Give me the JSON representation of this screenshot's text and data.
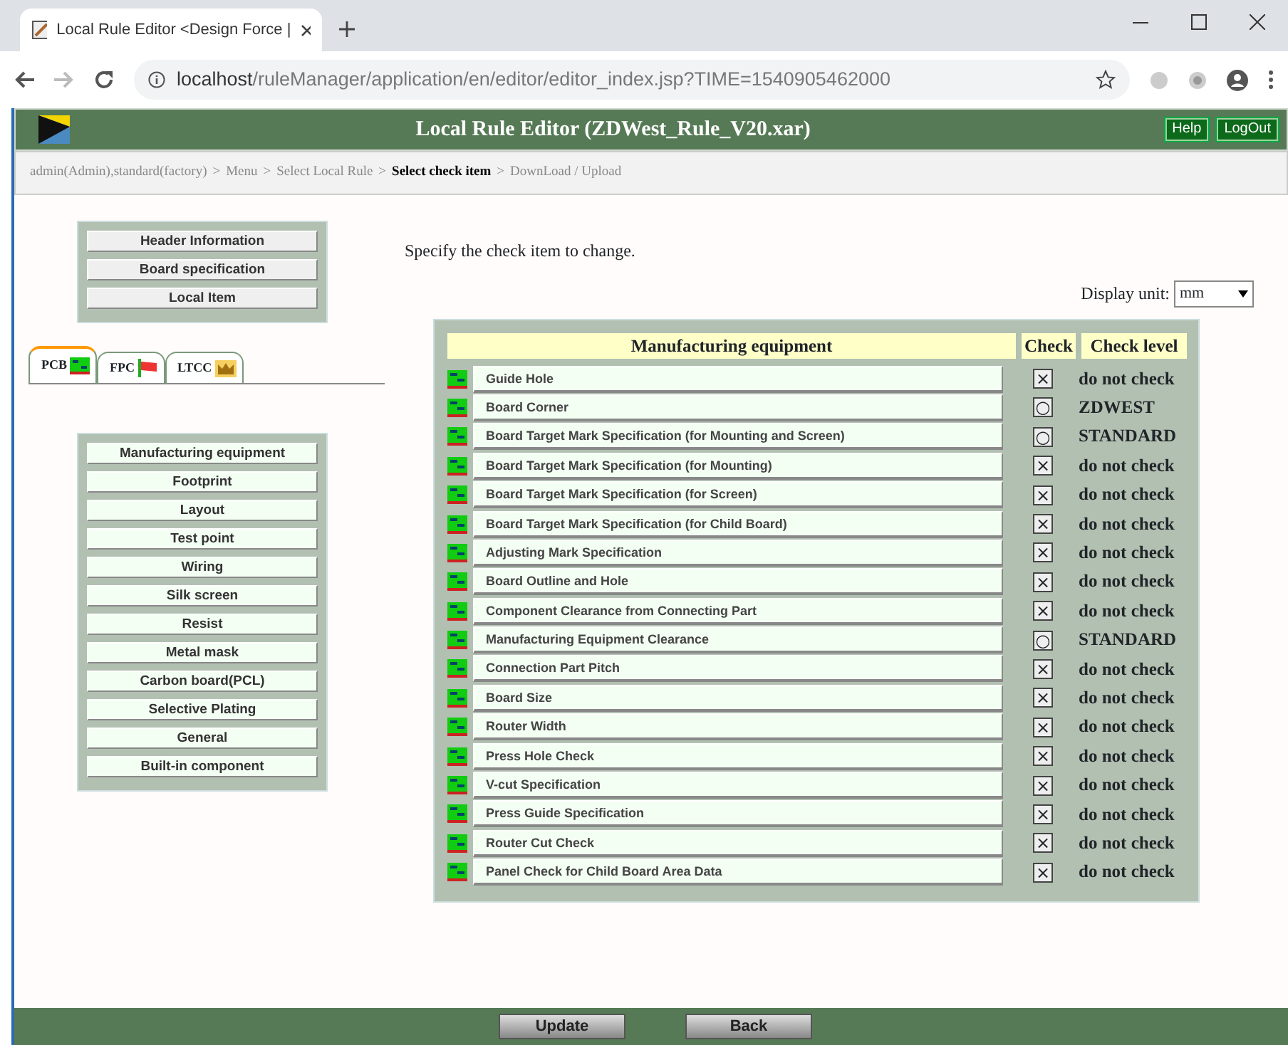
{
  "browser": {
    "tab_title": "Local Rule Editor <Design Force |",
    "url_host": "localhost",
    "url_path": "/ruleManager/application/en/editor/editor_index.jsp?TIME=1540905462000"
  },
  "header": {
    "title": "Local Rule Editor (ZDWest_Rule_V20.xar)",
    "buttons": [
      "Help",
      "LogOut"
    ]
  },
  "breadcrumb": [
    {
      "kind": "link",
      "label": "admin(Admin),standard(factory)",
      "current": false
    },
    {
      "kind": "separator",
      "label": ">"
    },
    {
      "kind": "link",
      "label": "Menu",
      "current": false
    },
    {
      "kind": "separator",
      "label": ">"
    },
    {
      "kind": "link",
      "label": "Select Local Rule",
      "current": false
    },
    {
      "kind": "separator",
      "label": ">"
    },
    {
      "kind": "link",
      "label": "Select check item",
      "current": true
    },
    {
      "kind": "separator",
      "label": ">"
    },
    {
      "kind": "link",
      "label": "DownLoad / Upload",
      "current": false
    }
  ],
  "top_menu": [
    "Header Information",
    "Board specification",
    "Local Item"
  ],
  "board_tabs": [
    {
      "label": "PCB",
      "selected": true
    },
    {
      "label": "FPC",
      "selected": false
    },
    {
      "label": "LTCC",
      "selected": false
    }
  ],
  "categories": [
    "Manufacturing equipment",
    "Footprint",
    "Layout",
    "Test point",
    "Wiring",
    "Silk screen",
    "Resist",
    "Metal mask",
    "Carbon board(PCL)",
    "Selective Plating",
    "General",
    "Built-in component"
  ],
  "instruction": "Specify the check item to change.",
  "display_unit": {
    "label": "Display unit:",
    "value": "mm"
  },
  "table": {
    "columns": [
      "Manufacturing equipment",
      "Check",
      "Check level"
    ],
    "rows": [
      {
        "item": "Guide Hole",
        "check": "×",
        "level": "do not check"
      },
      {
        "item": "Board Corner",
        "check": "○",
        "level": "ZDWEST"
      },
      {
        "item": "Board Target Mark Specification (for Mounting and Screen)",
        "check": "○",
        "level": "STANDARD"
      },
      {
        "item": "Board Target Mark Specification (for Mounting)",
        "check": "×",
        "level": "do not check"
      },
      {
        "item": "Board Target Mark Specification (for Screen)",
        "check": "×",
        "level": "do not check"
      },
      {
        "item": "Board Target Mark Specification (for Child Board)",
        "check": "×",
        "level": "do not check"
      },
      {
        "item": "Adjusting Mark Specification",
        "check": "×",
        "level": "do not check"
      },
      {
        "item": "Board Outline and Hole",
        "check": "×",
        "level": "do not check"
      },
      {
        "item": "Component Clearance from Connecting Part",
        "check": "×",
        "level": "do not check"
      },
      {
        "item": "Manufacturing Equipment Clearance",
        "check": "○",
        "level": "STANDARD"
      },
      {
        "item": "Connection Part Pitch",
        "check": "×",
        "level": "do not check"
      },
      {
        "item": "Board Size",
        "check": "×",
        "level": "do not check"
      },
      {
        "item": "Router Width",
        "check": "×",
        "level": "do not check"
      },
      {
        "item": "Press Hole Check",
        "check": "×",
        "level": "do not check"
      },
      {
        "item": "V-cut Specification",
        "check": "×",
        "level": "do not check"
      },
      {
        "item": "Press Guide Specification",
        "check": "×",
        "level": "do not check"
      },
      {
        "item": "Router Cut Check",
        "check": "×",
        "level": "do not check"
      },
      {
        "item": "Panel Check for Child Board Area Data",
        "check": "×",
        "level": "do not check"
      }
    ]
  },
  "footer_buttons": [
    "Update",
    "Back"
  ]
}
